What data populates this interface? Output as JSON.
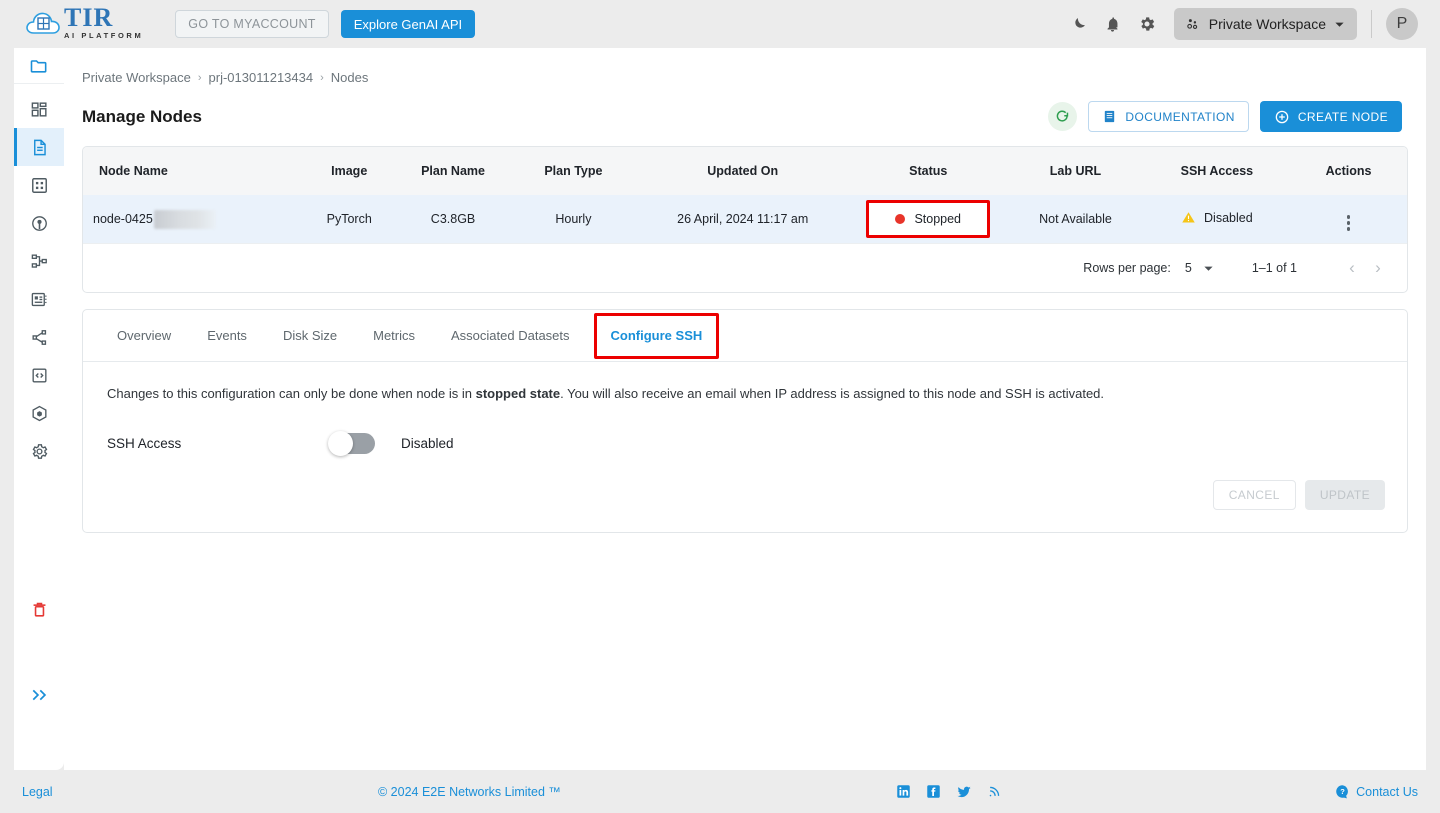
{
  "header": {
    "logo_name": "TIR",
    "logo_sub": "AI PLATFORM",
    "myaccount_label": "GO TO MYACCOUNT",
    "genai_label": "Explore GenAI API",
    "icons": [
      "dark-mode-icon",
      "notifications-icon",
      "settings-icon"
    ],
    "workspace_label": "Private Workspace",
    "avatar_initial": "P"
  },
  "sidebar": {
    "top_icon": "folder-icon",
    "items": [
      {
        "icon": "dashboard-icon",
        "active": false
      },
      {
        "icon": "notebook-icon",
        "active": true
      },
      {
        "icon": "grid-icon",
        "active": false
      },
      {
        "icon": "model-endpoint-icon",
        "active": false
      },
      {
        "icon": "pipeline-icon",
        "active": false
      },
      {
        "icon": "dataset-icon",
        "active": false
      },
      {
        "icon": "share-icon",
        "active": false
      },
      {
        "icon": "code-clipboard-icon",
        "active": false
      },
      {
        "icon": "container-registry-icon",
        "active": false
      },
      {
        "icon": "settings-gear-icon",
        "active": false
      }
    ],
    "trash_icon": "trash-icon",
    "expand_icon": "expand-chevrons-icon"
  },
  "breadcrumb": {
    "items": [
      "Private Workspace",
      "prj-013011213434",
      "Nodes"
    ],
    "separator": "›"
  },
  "page": {
    "title": "Manage Nodes",
    "refresh_icon": "refresh-icon",
    "documentation_label": "DOCUMENTATION",
    "documentation_icon": "document-icon",
    "create_node_label": "CREATE NODE",
    "create_node_icon": "plus-circle-icon"
  },
  "table": {
    "columns": [
      "Node Name",
      "Image",
      "Plan Name",
      "Plan Type",
      "Updated On",
      "Status",
      "Lab URL",
      "SSH Access",
      "Actions"
    ],
    "rows": [
      {
        "node_name": "node-0425",
        "node_name_redacted": true,
        "image": "PyTorch",
        "plan_name": "C3.8GB",
        "plan_type": "Hourly",
        "updated_on": "26 April, 2024 11:17 am",
        "status": "Stopped",
        "status_color": "#e8342a",
        "status_highlighted": true,
        "lab_url": "Not Available",
        "ssh_access": "Disabled",
        "ssh_icon": "warning-triangle-icon",
        "actions_icon": "kebab-menu-icon"
      }
    ]
  },
  "pagination": {
    "rows_per_page_label": "Rows per page:",
    "rows_per_page_value": "5",
    "range_label": "1–1 of 1",
    "prev_icon": "‹",
    "next_icon": "›"
  },
  "tabs": {
    "items": [
      {
        "label": "Overview",
        "active": false
      },
      {
        "label": "Events",
        "active": false
      },
      {
        "label": "Disk Size",
        "active": false
      },
      {
        "label": "Metrics",
        "active": false
      },
      {
        "label": "Associated Datasets",
        "active": false
      },
      {
        "label": "Configure SSH",
        "active": true
      }
    ]
  },
  "panel": {
    "note_part1": "Changes to this configuration can only be done when node is in ",
    "note_bold": "stopped state",
    "note_part2": ". You will also receive an email when IP address is assigned to this node and SSH is activated.",
    "ssh_access_label": "SSH Access",
    "toggle_on": false,
    "toggle_state_label": "Disabled",
    "cancel_label": "CANCEL",
    "update_label": "UPDATE"
  },
  "footer": {
    "legal_label": "Legal",
    "copyright": "© 2024 E2E Networks Limited ™",
    "social": [
      "linkedin-icon",
      "facebook-icon",
      "twitter-icon",
      "rss-icon"
    ],
    "contact_label": "Contact Us",
    "contact_icon": "question-circle-icon"
  },
  "colors": {
    "accent_blue": "#1a8fd8",
    "annotation_red": "#ec0000",
    "status_red": "#e8342a",
    "warning_yellow": "#f5c518",
    "refresh_green": "#2e9e4f"
  }
}
